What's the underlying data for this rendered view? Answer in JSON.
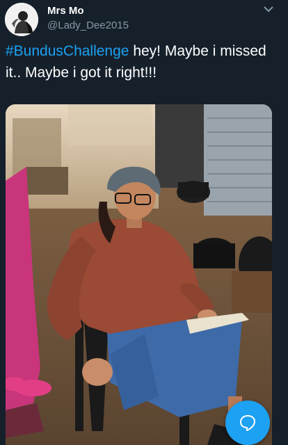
{
  "tweet": {
    "author_name": "Mrs Mo",
    "author_handle": "@Lady_Dee2015",
    "hashtag": "#BundusChallenge",
    "text_rest": " hey! Maybe i missed it.. Maybe i got it right!!!"
  },
  "icons": {
    "avatar": "avatar-image",
    "caret": "chevron-down-icon",
    "compose": "speech-bubble-icon"
  },
  "colors": {
    "background": "#15202b",
    "accent": "#1da1f2",
    "secondary_text": "#8899a6"
  }
}
